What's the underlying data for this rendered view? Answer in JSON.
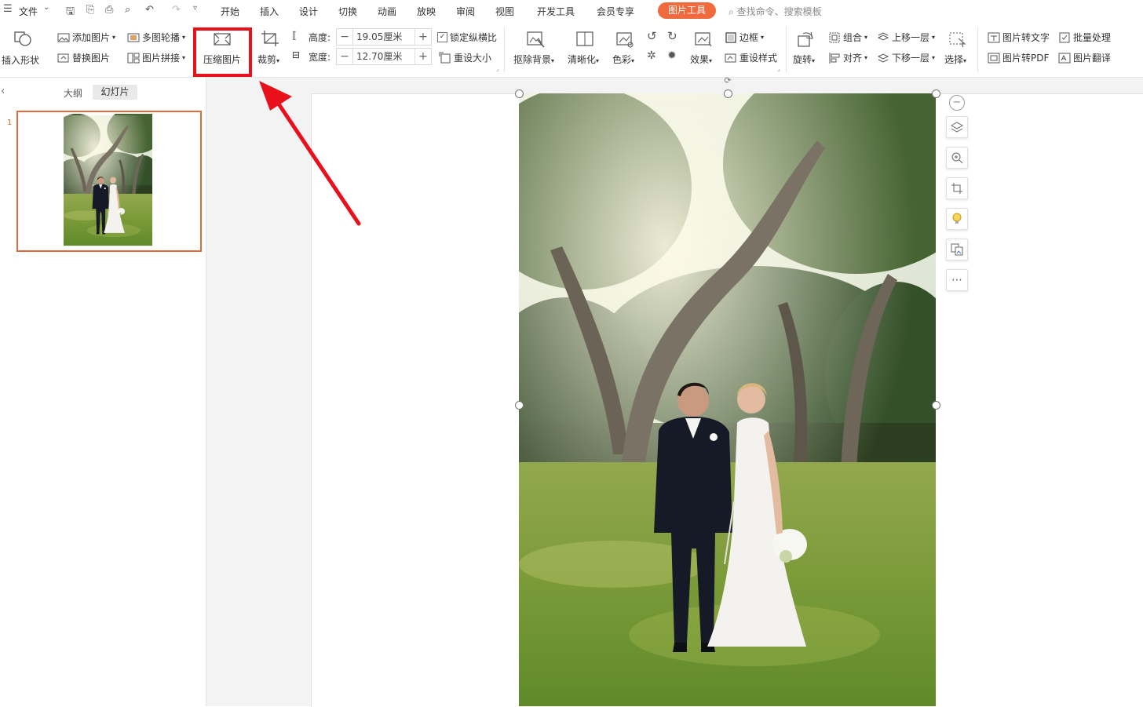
{
  "menu": {
    "file": "文件",
    "tabs": [
      "开始",
      "插入",
      "设计",
      "切换",
      "动画",
      "放映",
      "审阅",
      "视图",
      "开发工具",
      "会员专享"
    ],
    "active_tab": "图片工具",
    "search_placeholder": "查找命令、搜索模板"
  },
  "ribbon": {
    "insert_shape": "插入形状",
    "add_image": "添加图片",
    "replace_image": "替换图片",
    "multi_carousel": "多图轮播",
    "image_stitch": "图片拼接",
    "compress_image": "压缩图片",
    "crop": "裁剪",
    "height_label": "高度:",
    "height_value": "19.05厘米",
    "width_label": "宽度:",
    "width_value": "12.70厘米",
    "lock_ratio": "锁定纵横比",
    "reset_size": "重设大小",
    "remove_bg": "抠除背景",
    "sharpen": "清晰化",
    "color": "色彩",
    "effects": "效果",
    "border": "边框",
    "reset_style": "重设样式",
    "rotate": "旋转",
    "group": "组合",
    "align": "对齐",
    "bring_forward": "上移一层",
    "send_backward": "下移一层",
    "select": "选择",
    "img_to_text": "图片转文字",
    "img_to_pdf": "图片转PDF",
    "batch_process": "批量处理",
    "img_translate": "图片翻译"
  },
  "left_panel": {
    "outline_tab": "大纲",
    "slides_tab": "幻灯片",
    "slide_number": "1"
  },
  "colors": {
    "accent": "#f06a3e",
    "highlight": "#e8101b",
    "thumb_border": "#e06a3a"
  }
}
